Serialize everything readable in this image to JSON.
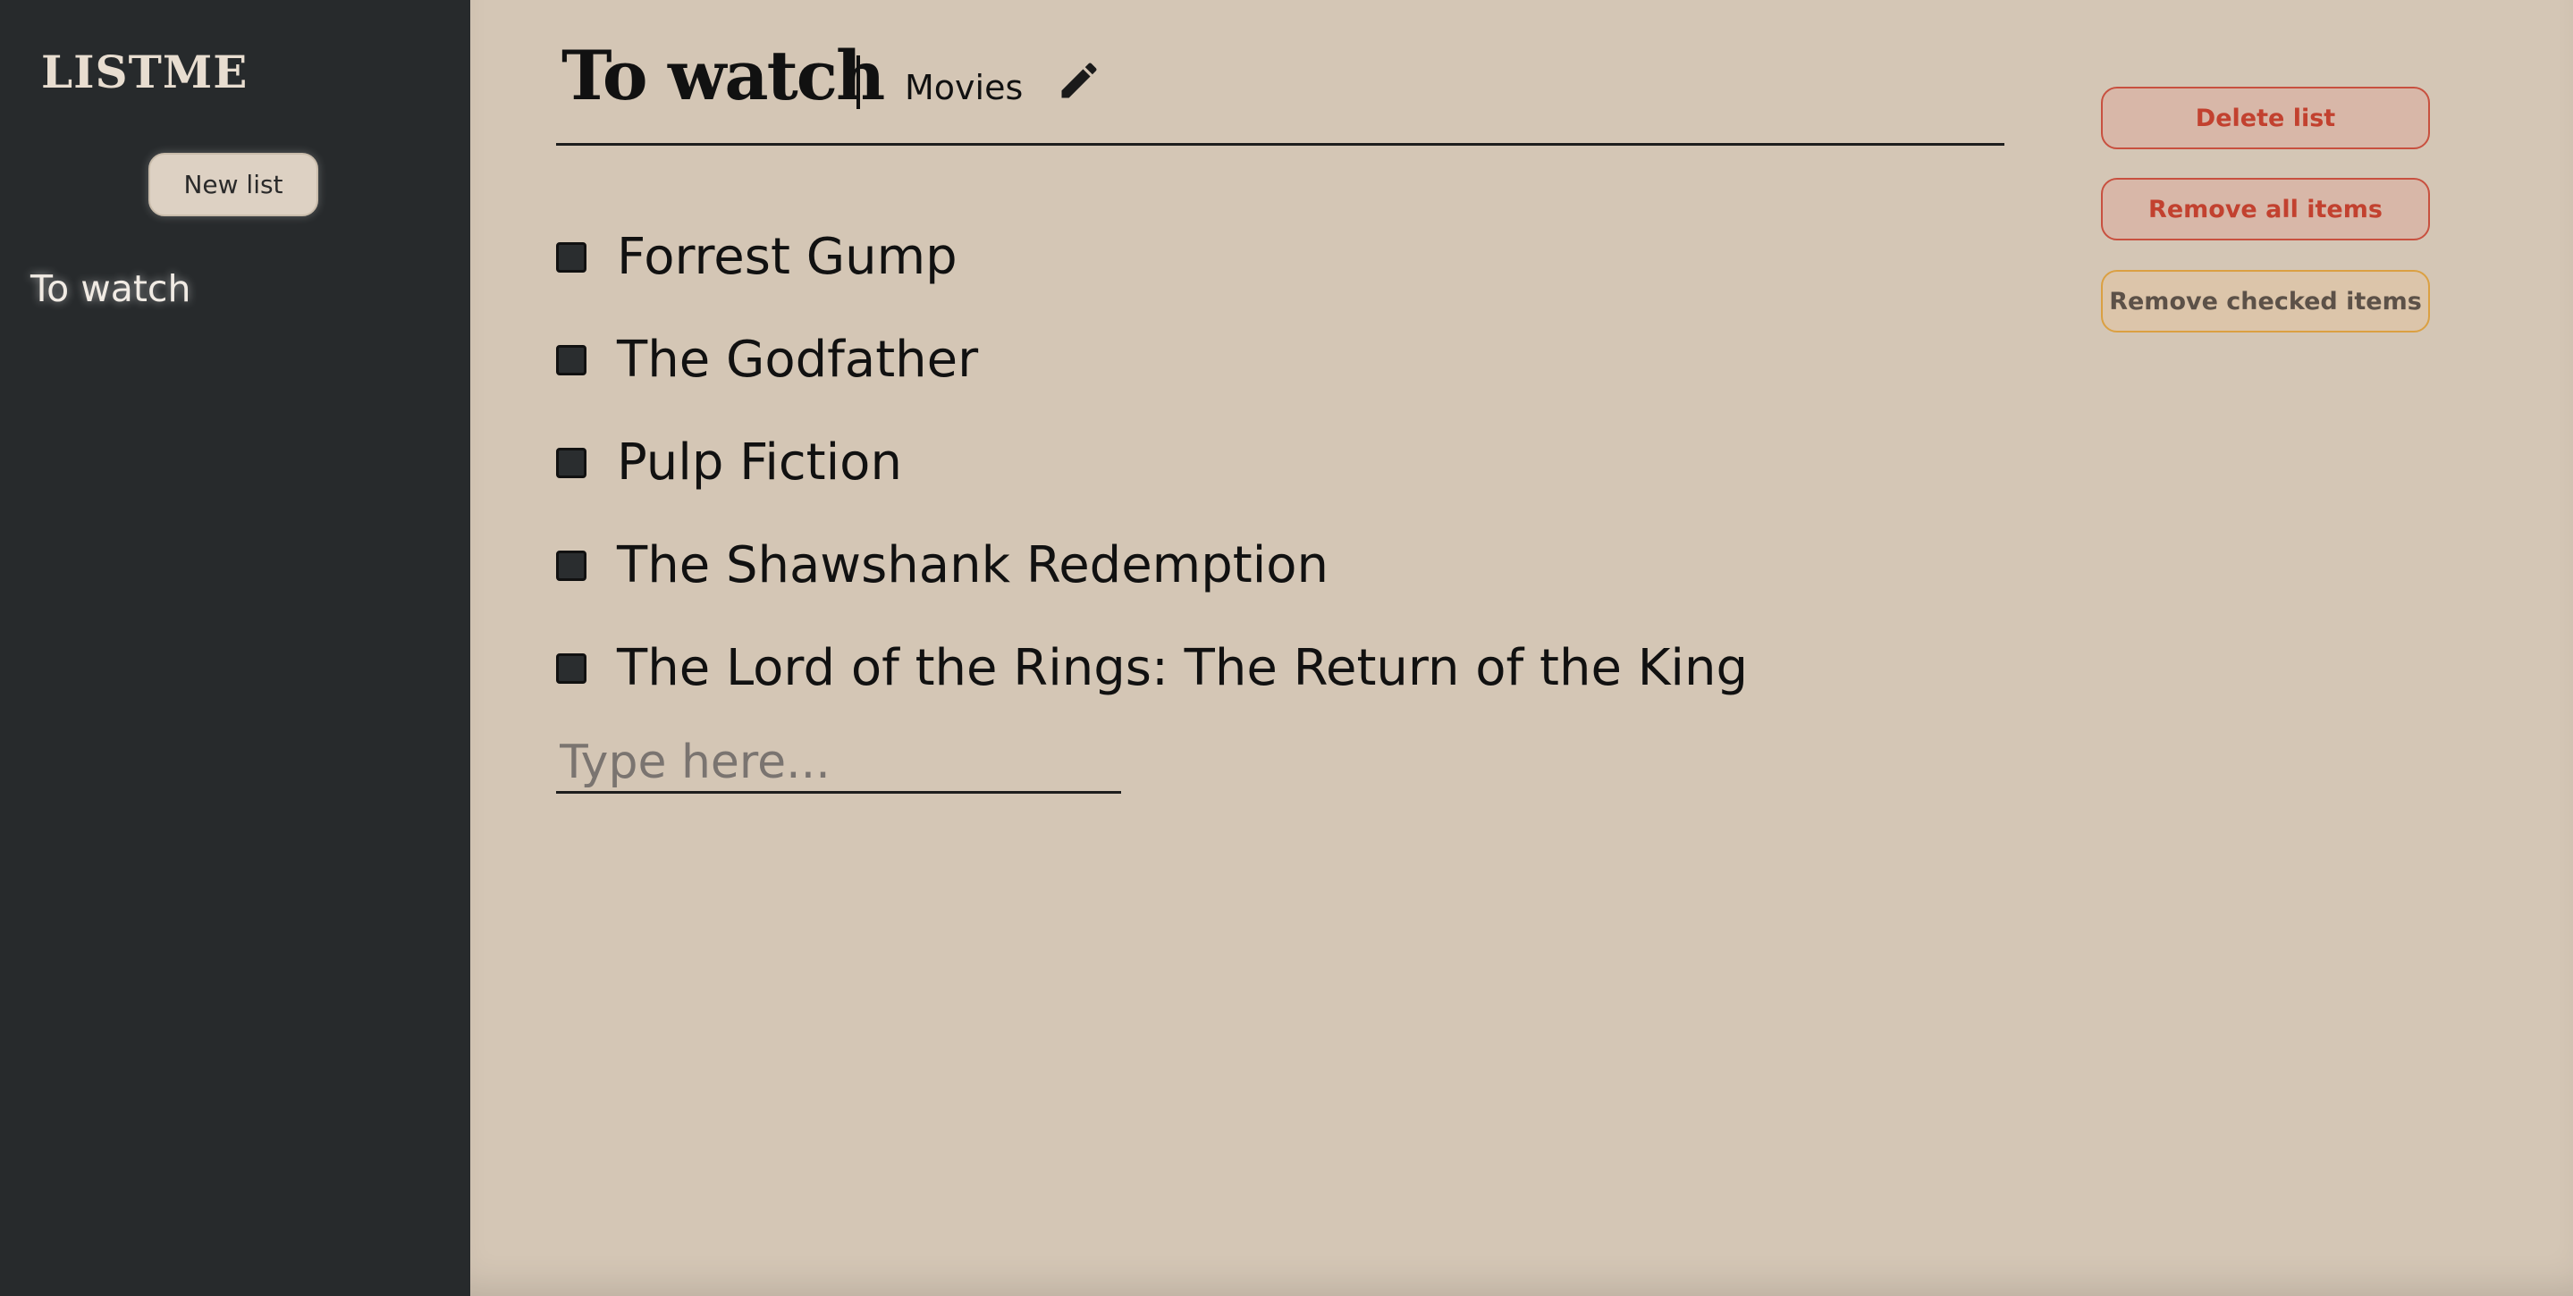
{
  "sidebar": {
    "logo": "LISTME",
    "new_list_label": "New list",
    "lists": [
      {
        "label": "To watch"
      }
    ]
  },
  "list": {
    "title": "To watch",
    "category": "Movies",
    "items": [
      {
        "label": "Forrest Gump",
        "checked": false
      },
      {
        "label": "The Godfather",
        "checked": false
      },
      {
        "label": "Pulp Fiction",
        "checked": false
      },
      {
        "label": "The Shawshank Redemption",
        "checked": false
      },
      {
        "label": "The Lord of the Rings: The Return of the King",
        "checked": false
      }
    ],
    "new_item_placeholder": "Type here...",
    "edit_icon": "pencil-icon"
  },
  "actions": {
    "delete_list_label": "Delete list",
    "remove_all_label": "Remove all items",
    "remove_checked_label": "Remove checked items"
  },
  "colors": {
    "sidebar_bg": "#272a2c",
    "main_bg": "#d4c6b5",
    "danger": "#c2412f",
    "warning_border": "#dba042"
  }
}
